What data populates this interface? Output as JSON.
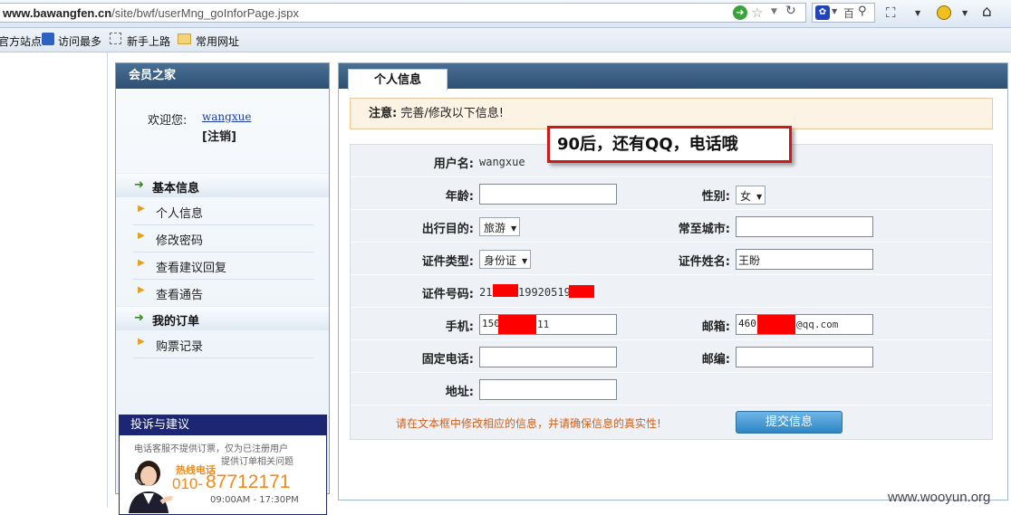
{
  "browser": {
    "url_domain": "www.bawangfen.cn",
    "url_path": "/site/bwf/userMng_goInforPage.jspx",
    "bookmarks": [
      "官方站点",
      "访问最多",
      "新手上路",
      "常用网址"
    ]
  },
  "sidebar": {
    "title": "会员之家",
    "welcome_label": "欢迎您:",
    "username": "wangxue",
    "logout": "[注销]",
    "sections": [
      {
        "title": "基本信息",
        "items": [
          "个人信息",
          "修改密码",
          "查看建议回复",
          "查看通告"
        ]
      },
      {
        "title": "我的订单",
        "items": [
          "购票记录"
        ]
      }
    ],
    "complaint": {
      "title": "投诉与建议",
      "line1": "电话客服不提供订票，仅为已注册用户",
      "line2": "提供订单相关问题",
      "hotline_label": "热线电话",
      "hotline_prefix": "010-",
      "hotline_number": "87712171",
      "hours": "09:00AM - 17:30PM"
    }
  },
  "main": {
    "tab": "个人信息",
    "notice_label": "注意:",
    "notice_text": "完善/修改以下信息!",
    "form": {
      "username_label": "用户名:",
      "username_value": "wangxue",
      "age_label": "年龄:",
      "age_value": "",
      "gender_label": "性别:",
      "gender_value": "女",
      "purpose_label": "出行目的:",
      "purpose_value": "旅游",
      "city_label": "常至城市:",
      "city_value": "",
      "idtype_label": "证件类型:",
      "idtype_value": "身份证",
      "idname_label": "证件姓名:",
      "idname_value": "王盼",
      "idno_label": "证件号码:",
      "idno_part1": "21",
      "idno_part2": "19920519",
      "phone_label": "手机:",
      "phone_part1": "150",
      "phone_part2": "11",
      "email_label": "邮箱:",
      "email_part1": "460",
      "email_part2": "@qq.com",
      "tel_label": "固定电话:",
      "tel_value": "",
      "zip_label": "邮编:",
      "zip_value": "",
      "address_label": "地址:",
      "address_value": ""
    },
    "hint": "请在文本框中修改相应的信息，并请确保信息的真实性!",
    "submit": "提交信息"
  },
  "callout": "90后，还有QQ，电话哦",
  "watermark": "www.wooyun.org",
  "colors": {
    "header_blue": "#2d5073",
    "notice_bg": "#fdf3e5",
    "redaction": "#ff0000",
    "callout_border": "#cc1a1a",
    "hint": "#d2601a"
  }
}
